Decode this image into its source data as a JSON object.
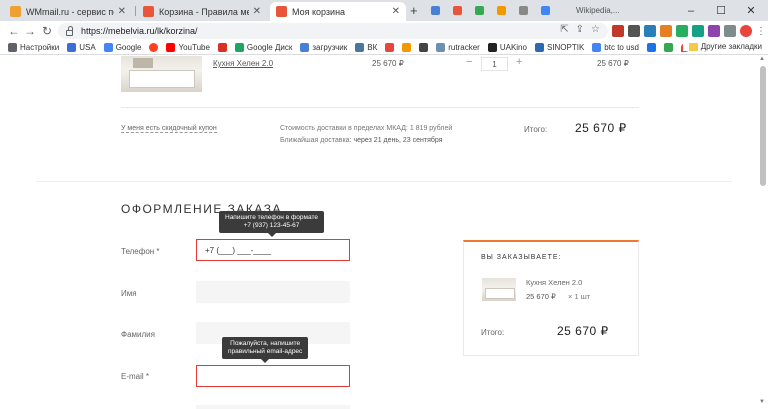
{
  "browser": {
    "tabs": [
      {
        "title": "WMmail.ru - сервис почтовых ре",
        "favicon_color": "#f0a030"
      },
      {
        "title": "Корзина - Правила мебели",
        "favicon_color": "#e8553a"
      },
      {
        "title": "Моя корзина",
        "favicon_color": "#e8553a"
      }
    ],
    "ghost_tab_title": "Wikipedia,...",
    "new_tab_symbol": "+",
    "window_controls": {
      "minimize": "–",
      "maximize": "☐",
      "close": "✕"
    },
    "url": "https://mebelvia.ru/lk/korzina/",
    "bookmarks": [
      {
        "label": "Настройки",
        "color": "#5f6368"
      },
      {
        "label": "USA",
        "color": "#3c6fd1"
      },
      {
        "label": "Google",
        "color": "#4285f4"
      },
      {
        "label": "",
        "color": "#fc3f1d"
      },
      {
        "label": "YouTube",
        "color": "#ff0000"
      },
      {
        "label": "",
        "color": "#d93025"
      },
      {
        "label": "Google Диск",
        "color": "#1fa463"
      },
      {
        "label": "загрузчик",
        "color": "#4a7fd6"
      },
      {
        "label": "ВК",
        "color": "#4c75a3"
      },
      {
        "label": "",
        "color": "#e8453c"
      },
      {
        "label": "",
        "color": "#f29900"
      },
      {
        "label": "",
        "color": "#444444"
      },
      {
        "label": "rutracker",
        "color": "#6d8fb3"
      },
      {
        "label": "UAKino",
        "color": "#222222"
      },
      {
        "label": "SINOPTIK",
        "color": "#2a6ab0"
      },
      {
        "label": "btc to usd",
        "color": "#4285f4"
      },
      {
        "label": "",
        "color": "#1a73e8"
      },
      {
        "label": "",
        "color": "#34a853"
      },
      {
        "label": "maps",
        "color": "#ea4335"
      }
    ],
    "other_bookmarks": "Другие закладки"
  },
  "cart": {
    "product_name": "Кухня Хелен 2.0",
    "price": "25 670 ₽",
    "qty": "1",
    "qty_minus": "−",
    "qty_plus": "+",
    "line_total": "25 670 ₽",
    "coupon_link": "У меня есть скидочный купон",
    "delivery_cost": "Стоимость доставки в пределах МКАД: 1 819 рублей",
    "delivery_date_prefix": "Ближайшая доставка:",
    "delivery_date": "через 21 день, 23 сентября",
    "total_label": "Итого:",
    "total_value": "25 670 ₽"
  },
  "checkout": {
    "title": "ОФОРМЛЕНИЕ ЗАКАЗА",
    "phone_tooltip_line1": "Напишите телефон в формате",
    "phone_tooltip_line2": "+7 (937) 123-45-67",
    "phone_label": "Телефон *",
    "phone_value": "+7 (___) ___-____",
    "name_label": "Имя",
    "surname_label": "Фамилия",
    "email_tooltip_line1": "Пожалуйста, напишите",
    "email_tooltip_line2": "правильный email-адрес",
    "email_label": "E-mail *"
  },
  "order_summary": {
    "title": "ВЫ ЗАКАЗЫВАЕТЕ:",
    "item_name": "Кухня Хелен 2.0",
    "item_price": "25 670 ₽",
    "item_qty": "× 1 шт",
    "total_label": "Итого:",
    "total_value": "25 670 ₽"
  }
}
